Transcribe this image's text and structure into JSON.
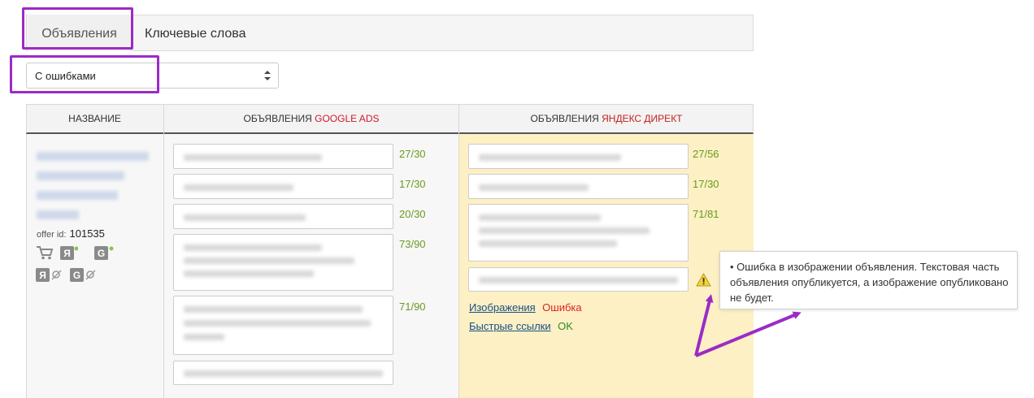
{
  "tabs": {
    "ads_label": "Объявления",
    "keywords_label": "Ключевые слова"
  },
  "filter": {
    "selected": "С ошибками"
  },
  "table": {
    "headers": {
      "name": "НАЗВАНИЕ",
      "google_prefix": "ОБЪЯВЛЕНИЯ ",
      "google_accent": "GOOGLE ADS",
      "yandex_prefix": "ОБЪЯВЛЕНИЯ ",
      "yandex_accent": "ЯНДЕКС ДИРЕКТ"
    },
    "offer_label": "offer id:",
    "offer_id": "101535",
    "google_counts": [
      "27/30",
      "17/30",
      "20/30",
      "73/90",
      "71/90"
    ],
    "yandex_counts": [
      "27/56",
      "17/30",
      "71/81"
    ],
    "yandex_links": {
      "images_label": "Изображения",
      "images_status": "Ошибка",
      "quicklinks_label": "Быстрые ссылки",
      "quicklinks_status": "OK"
    }
  },
  "tooltip": {
    "text": "• Ошибка в изображении объявления. Текстовая часть объявления опубликуется, а изображение опубликовано не будет."
  },
  "colors": {
    "highlight": "#9b2bc6",
    "yandex_column_bg": "#fcf0c4",
    "count_green": "#6a9a1f",
    "error_red": "#e02020",
    "ok_green": "#2e8b22"
  }
}
